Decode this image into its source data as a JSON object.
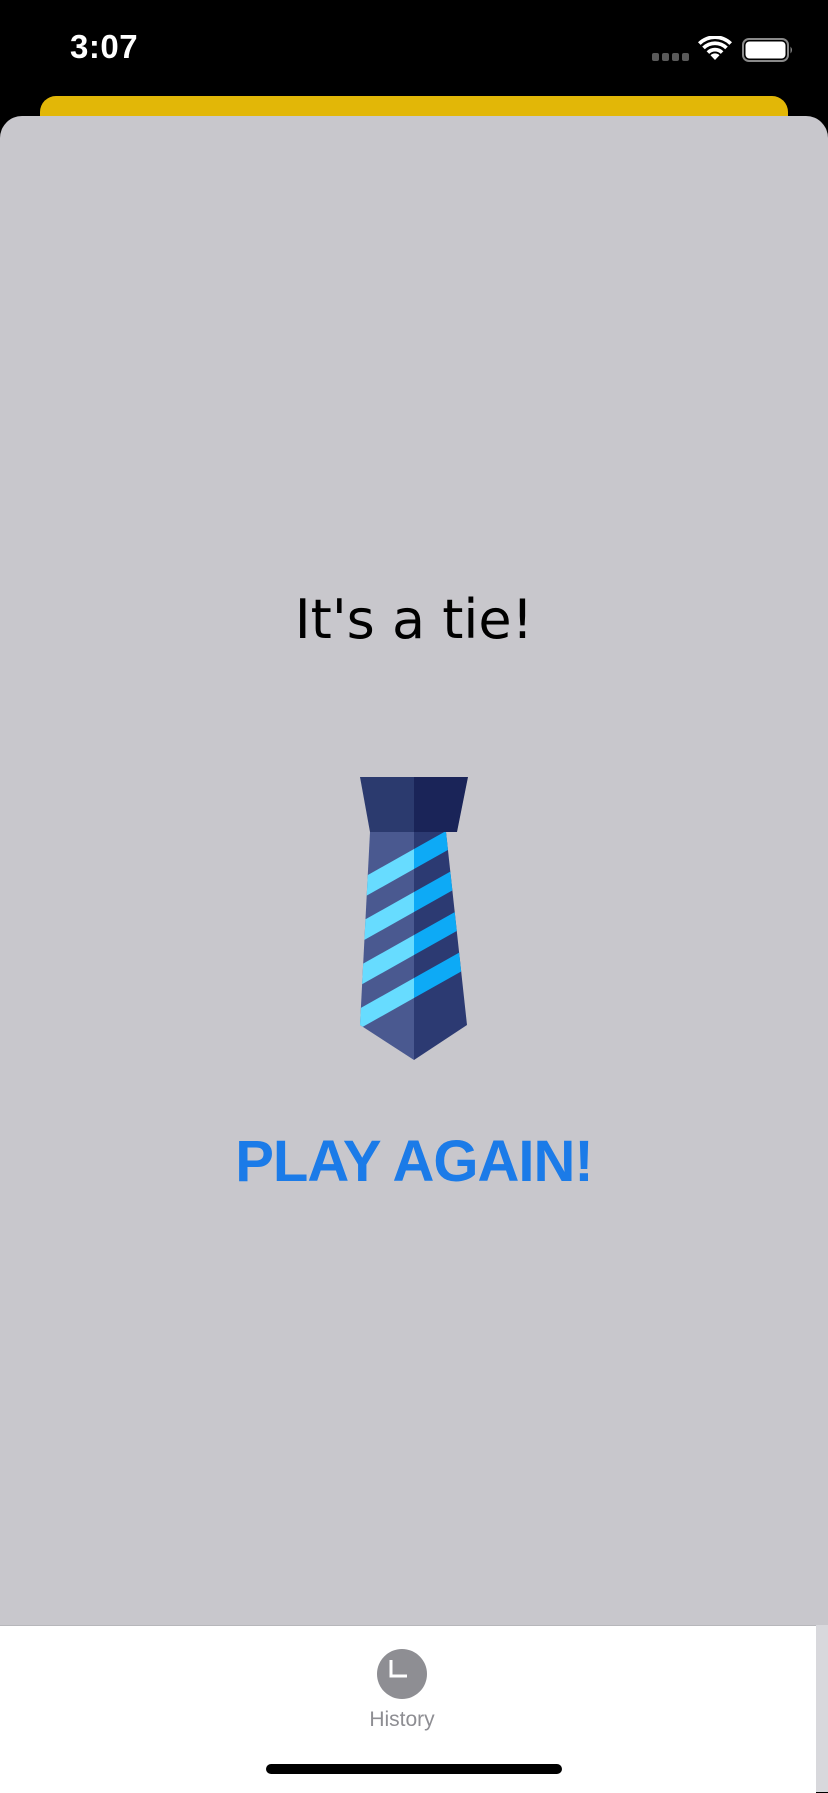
{
  "status_bar": {
    "time": "3:07"
  },
  "result": {
    "message": "It's a tie!",
    "image": "necktie-icon"
  },
  "actions": {
    "play_again_label": "PLAY AGAIN!"
  },
  "tab_bar": {
    "items": [
      {
        "label": "History",
        "icon": "clock-icon",
        "selected": false
      }
    ]
  },
  "colors": {
    "sheet_accent": "#E2B707",
    "card_background": "#C8C7CC",
    "play_again": "#1B7BE8",
    "tab_inactive": "#8E8E93"
  }
}
